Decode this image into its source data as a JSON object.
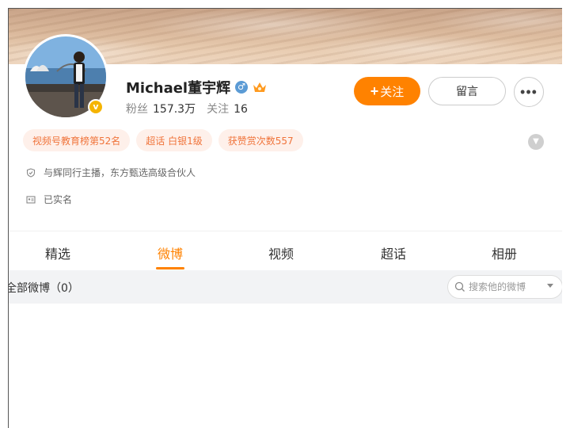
{
  "profile": {
    "name": "Michael董宇辉",
    "stats": {
      "followers_label": "粉丝",
      "followers_value": "157.3万",
      "following_label": "关注",
      "following_value": "16"
    }
  },
  "actions": {
    "follow_label": "关注",
    "follow_plus": "+",
    "message_label": "留言",
    "more_label": "•••"
  },
  "tags": [
    "视频号教育榜第52名",
    "超话 白银1级",
    "获赞赏次数557"
  ],
  "info": {
    "role": "与辉同行主播，东方甄选高级合伙人",
    "verification": "已实名"
  },
  "tabs": [
    "精选",
    "微博",
    "视频",
    "超话",
    "相册"
  ],
  "active_tab": "微博",
  "filter": {
    "label": "全部微博（0）",
    "search_placeholder": "搜索他的微博"
  },
  "colors": {
    "accent": "#ff8200",
    "tag_bg": "#fef0ea",
    "tag_text": "#f0743b"
  },
  "icons": [
    "gender-male-icon",
    "crown-icon",
    "verified-badge-icon",
    "shield-icon",
    "id-card-icon",
    "search-icon",
    "chevron-down-icon",
    "more-icon"
  ]
}
